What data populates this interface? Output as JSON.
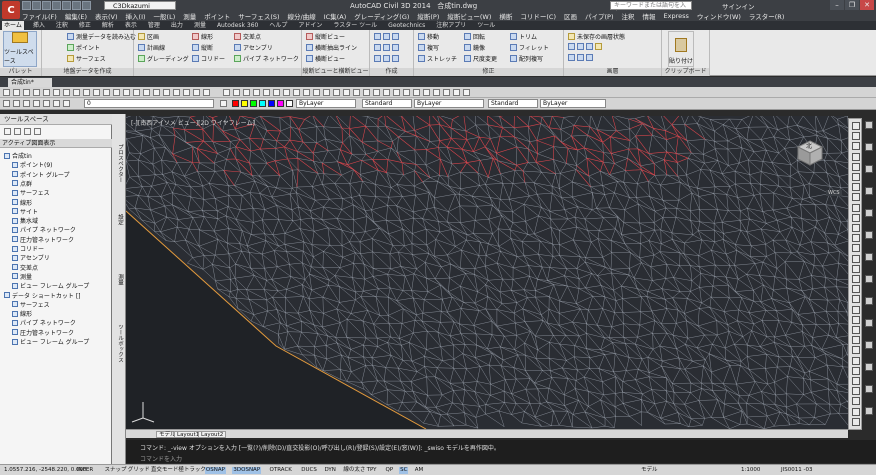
{
  "app": {
    "title": "AutoCAD Civil 3D 2014",
    "file": "合成tin.dwg",
    "workspace": "C3Dkazumi",
    "search_placeholder": "キーワードまたは語句を入力",
    "signin": "サインイン"
  },
  "menu": [
    "ファイル(F)",
    "編集(E)",
    "表示(V)",
    "挿入(I)",
    "一般(L)",
    "測量",
    "ポイント",
    "サーフェス(S)",
    "線分/曲線",
    "IC集(A)",
    "グレーディング(G)",
    "縦断(P)",
    "縦断ビュー(W)",
    "横断",
    "コリドー(C)",
    "区画",
    "パイプ(P)",
    "注釈",
    "情報",
    "Express",
    "ウィンドウ(W)",
    "ラスター(R)"
  ],
  "ribbon_tabs": [
    "ホーム",
    "挿入",
    "注釈",
    "修正",
    "解析",
    "表示",
    "管理",
    "出力",
    "測量",
    "Autodesk 360",
    "ヘルプ",
    "アドイン",
    "ラスター ツール",
    "Geotechnics",
    "注釈アプリ",
    "ツール"
  ],
  "ribbon": {
    "palette": {
      "big": "ツールスペース",
      "label": "パレット"
    },
    "ground": {
      "items": [
        "測量データを読み込む",
        "ポイント",
        "サーフェス"
      ],
      "label": "地盤データを作成"
    },
    "create": {
      "items": [
        "区画",
        "計画線",
        "グレーディング",
        "線形",
        "縦断",
        "コリドー",
        "交差点",
        "アセンブリ",
        "パイプ ネットワーク"
      ],
      "label": ""
    },
    "profile": {
      "items": [
        "縦断ビュー",
        "横断抽出ライン",
        "横断ビュー"
      ],
      "label": "縦断ビューと横断ビュー"
    },
    "draw": {
      "label": "作成"
    },
    "modify": {
      "items": [
        "移動",
        "回転",
        "複写",
        "鏡像",
        "ストレッチ",
        "尺度変更",
        "トリム",
        "フィレット",
        "配列複写"
      ],
      "label": "修正"
    },
    "layers": {
      "value": "未保存の画層状態",
      "label": "画層"
    },
    "clip": {
      "big": "貼り付け",
      "label": "クリップボード"
    }
  },
  "doc_tab": "合成tin*",
  "layer_combo": "0",
  "bylayer": "ByLayer",
  "standard": "Standard",
  "linetype": "ByLayer",
  "standard2": "Standard",
  "lineweight": "ByLayer",
  "palette": {
    "title": "ツールスペース",
    "header": "アクティブ図面表示",
    "tree": [
      "合成tin",
      "ポイント(9)",
      "ポイント グループ",
      "点群",
      "サーフェス",
      "線形",
      "サイト",
      "集水域",
      "パイプ ネットワーク",
      "圧力管ネットワーク",
      "コリドー",
      "アセンブリ",
      "交差点",
      "測量",
      "ビュー フレーム グループ",
      "データ ショートカット []",
      "サーフェス",
      "線形",
      "パイプ ネットワーク",
      "圧力管ネットワーク",
      "ビュー フレーム グループ"
    ],
    "vtabs": [
      "プロスペクター",
      "設定",
      "測量",
      "ツールボックス"
    ]
  },
  "viewport": {
    "label": "[-][南西アイソメ ビュー][2D ワイヤフレーム]",
    "cube_face": "北",
    "wcs": "WCS"
  },
  "layout_tabs": [
    "モデル",
    "Layout1",
    "Layout2"
  ],
  "command": {
    "line1": "コマンド: _-view オプションを入力 [一覧(?)/削除(D)/直交投影(O)/呼び出し(R)/登録(S)/設定(E)/窓(W)]: _swiso モデルを再作図中。",
    "line2": "コマンドを入力"
  },
  "status": {
    "coords": "1.0557.216, -2548.220, 0.000",
    "buttons": [
      "INFER",
      "スナップ",
      "グリッド",
      "直交モード",
      "極トラック",
      "OSNAP",
      "3DOSNAP",
      "OTRACK",
      "DUCS",
      "DYN",
      "線の太さ",
      "TPY",
      "QP",
      "SC",
      "AM"
    ],
    "right": [
      "モデル",
      "1:1000",
      "JIS0011 -03"
    ]
  }
}
